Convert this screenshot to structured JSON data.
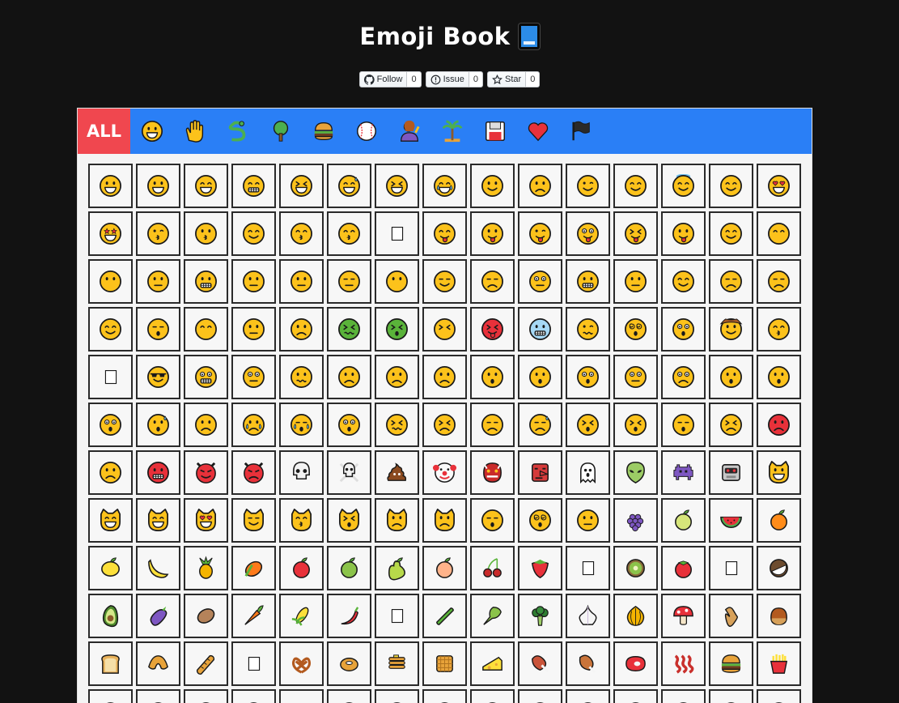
{
  "header": {
    "title": "Emoji Book",
    "title_icon": "blue-book-icon"
  },
  "github": {
    "follow": {
      "label": "Follow",
      "count": "0"
    },
    "issue": {
      "label": "Issue",
      "count": "0"
    },
    "star": {
      "label": "Star",
      "count": "0"
    }
  },
  "categories": {
    "all_label": "ALL",
    "items": [
      "smileys",
      "people",
      "animals",
      "nature",
      "food",
      "activities",
      "person-activity",
      "travel",
      "objects",
      "symbols",
      "flags"
    ]
  },
  "colors": {
    "nav": "#2a7ff6",
    "all": "#f0474f",
    "face": "#fcc21b",
    "bg": "#121212"
  },
  "grid": {
    "columns": 15,
    "rows": [
      [
        "grinning",
        "grinning-big-eyes",
        "grin-smile",
        "beaming",
        "squinting-laugh",
        "sweat-smile",
        "rolling-laugh",
        "tears-of-joy",
        "slight-smile",
        "upside-down",
        "wink",
        "smiling-eyes",
        "halo",
        "hearts",
        "heart-eyes"
      ],
      [
        "star-struck",
        "kiss-heart",
        "kissing",
        "smile-blush",
        "kiss-closed",
        "kissing-smile",
        "blank",
        "yum",
        "tongue",
        "wink-tongue",
        "zany",
        "squint-tongue",
        "money-mouth",
        "hugging",
        "hand-over-mouth"
      ],
      [
        "shushing",
        "thinking",
        "zipper",
        "raised-brow",
        "neutral",
        "expressionless",
        "no-mouth",
        "smirk",
        "unamused",
        "eye-roll",
        "grimace",
        "lying",
        "relieved",
        "pensive",
        "sleepy"
      ],
      [
        "drooling",
        "sleeping",
        "mask",
        "thermometer",
        "bandage",
        "nauseated",
        "vomiting",
        "sneezing",
        "hot",
        "cold",
        "woozy",
        "dizzy",
        "exploding",
        "cowboy",
        "party"
      ],
      [
        "blank",
        "sunglasses",
        "nerd",
        "monocle",
        "confused",
        "worried",
        "slight-frown",
        "frown",
        "open-mouth",
        "hushed",
        "astonished",
        "flushed",
        "pleading",
        "frown-open",
        "anguished"
      ],
      [
        "fearful",
        "anxious-sweat",
        "sad-relieved",
        "crying",
        "loud-cry",
        "screaming",
        "confounded",
        "persevering",
        "disappointed",
        "downcast-sweat",
        "weary",
        "tired",
        "yawning",
        "triumph",
        "pouting"
      ],
      [
        "angry",
        "cursing",
        "devil-smile",
        "imp",
        "skull",
        "crossbones",
        "poop",
        "clown",
        "ogre",
        "goblin",
        "ghost",
        "alien",
        "space-invader",
        "robot",
        "cat-grin"
      ],
      [
        "cat-smile",
        "cat-joy",
        "cat-hearts",
        "cat-wry",
        "cat-kiss",
        "cat-weary",
        "cat-cry",
        "cat-pout",
        "face-exhale",
        "face-spiral",
        "face-clouds",
        "grapes",
        "melon",
        "watermelon",
        "tangerine"
      ],
      [
        "lemon",
        "banana",
        "pineapple",
        "mango",
        "red-apple",
        "green-apple",
        "pear",
        "peach",
        "cherries",
        "strawberry",
        "blank",
        "kiwi",
        "tomato",
        "blank",
        "coconut"
      ],
      [
        "avocado",
        "eggplant",
        "potato",
        "carrot",
        "corn",
        "hot-pepper",
        "blank",
        "cucumber",
        "leafy-green",
        "broccoli",
        "garlic",
        "onion",
        "mushroom",
        "peanuts",
        "chestnut"
      ],
      [
        "bread",
        "croissant",
        "baguette",
        "blank",
        "pretzel",
        "bagel",
        "pancakes",
        "waffle",
        "cheese",
        "meat-bone",
        "poultry-leg",
        "cut-meat",
        "bacon",
        "hamburger",
        "fries"
      ],
      [
        "pizza",
        "hotdog",
        "sandwich",
        "taco",
        "blank",
        "burrito",
        "stuffed-flatbread",
        "egg",
        "cooking",
        "shallow-pan",
        "salad",
        "popcorn",
        "butter",
        "salt",
        "canned"
      ]
    ]
  }
}
